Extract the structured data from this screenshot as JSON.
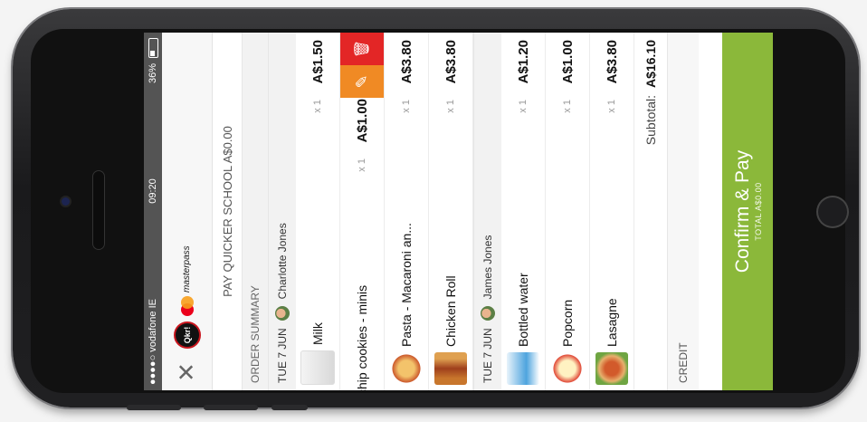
{
  "status": {
    "carrier": "●●●●○ vodafone IE",
    "time": "09:20",
    "battery": "36%"
  },
  "header": {
    "logo_text": "Qkr!",
    "brand": "masterpass"
  },
  "school": {
    "label": "PAY QUICKER SCHOOL A$0.00"
  },
  "summary_title": "ORDER SUMMARY",
  "groups": [
    {
      "date": "TUE 7 JUN",
      "person": "Charlotte  Jones",
      "items": [
        {
          "name": "Milk",
          "qty": "x 1",
          "price": "A$1.50"
        },
        {
          "name": "chip cookies - minis",
          "qty": "x 1",
          "price": "A$1.00"
        },
        {
          "name": "Pasta - Macaroni an...",
          "qty": "x 1",
          "price": "A$3.80"
        },
        {
          "name": "Chicken Roll",
          "qty": "x 1",
          "price": "A$3.80"
        }
      ]
    },
    {
      "date": "TUE 7 JUN",
      "person": "James Jones",
      "items": [
        {
          "name": "Bottled water",
          "qty": "x 1",
          "price": "A$1.20"
        },
        {
          "name": "Popcorn",
          "qty": "x 1",
          "price": "A$1.00"
        },
        {
          "name": "Lasagne",
          "qty": "x 1",
          "price": "A$3.80"
        }
      ]
    }
  ],
  "subtotal": {
    "label": "Subtotal:",
    "value": "A$16.10"
  },
  "credit": "CREDIT",
  "pay": {
    "label": "Confirm & Pay",
    "total": "TOTAL A$0.00"
  },
  "colors": {
    "accent": "#8bb83a",
    "edit": "#f08a24",
    "delete": "#e32626"
  },
  "icons": {
    "close": "close-icon",
    "edit": "pencil-icon",
    "delete": "trash-icon"
  }
}
